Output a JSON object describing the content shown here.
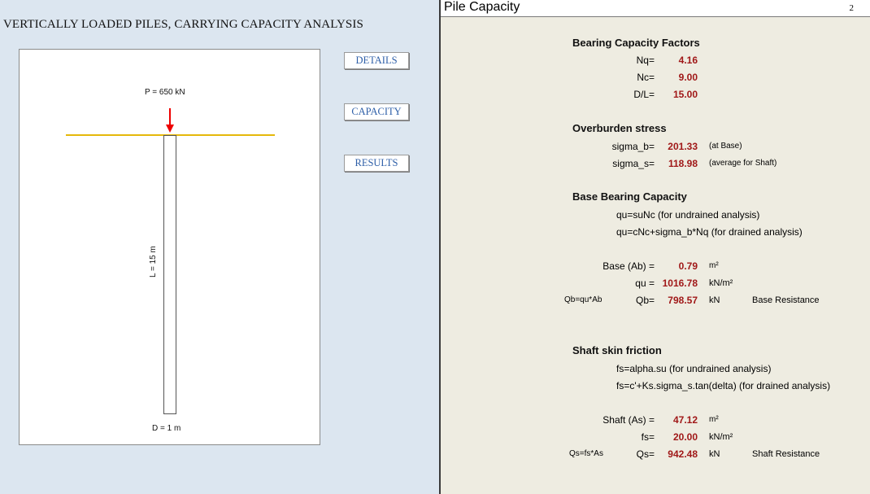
{
  "left_panel": {
    "title": "VERTICALLY LOADED PILES, CARRYING CAPACITY ANALYSIS",
    "buttons": {
      "details": "DETAILS",
      "capacity": "CAPACITY",
      "results": "RESULTS"
    },
    "diagram": {
      "load": "P = 650 kN",
      "length": "L = 15 m",
      "diameter": "D = 1 m"
    }
  },
  "sheet": {
    "title": "Pile Capacity",
    "page": "2",
    "bearing_factors": {
      "heading": "Bearing Capacity Factors",
      "nq_label": "Nq=",
      "nq_value": "4.16",
      "nc_label": "Nc=",
      "nc_value": "9.00",
      "dl_label": "D/L=",
      "dl_value": "15.00"
    },
    "overburden": {
      "heading": "Overburden stress",
      "sb_label": "sigma_b=",
      "sb_value": "201.33",
      "sb_note": "(at Base)",
      "ss_label": "sigma_s=",
      "ss_value": "118.98",
      "ss_note": "(average for Shaft)"
    },
    "base_capacity": {
      "heading": "Base Bearing Capacity",
      "formula1": "qu=suNc (for undrained analysis)",
      "formula2": "qu=cNc+sigma_b*Nq (for drained analysis)",
      "ab_label": "Base (Ab) =",
      "ab_value": "0.79",
      "ab_unit": "m²",
      "qu_label": "qu =",
      "qu_value": "1016.78",
      "qu_unit": "kN/m²",
      "qb_formula": "Qb=qu*Ab",
      "qb_label": "Qb=",
      "qb_value": "798.57",
      "qb_unit": "kN",
      "qb_note": "Base Resistance"
    },
    "shaft_friction": {
      "heading": "Shaft skin friction",
      "formula1": "fs=alpha.su (for undrained analysis)",
      "formula2": "fs=c'+Ks.sigma_s.tan(delta) (for drained analysis)",
      "as_label": "Shaft (As) =",
      "as_value": "47.12",
      "as_unit": "m²",
      "fs_label": "fs=",
      "fs_value": "20.00",
      "fs_unit": "kN/m²",
      "qs_formula": "Qs=fs*As",
      "qs_label": "Qs=",
      "qs_value": "942.48",
      "qs_unit": "kN",
      "qs_note": "Shaft Resistance"
    }
  },
  "colors": {
    "load_arrow": "#ee0000",
    "ground_line": "#e5b80b",
    "value_text": "#a01818",
    "button_text": "#2e5fa8"
  }
}
